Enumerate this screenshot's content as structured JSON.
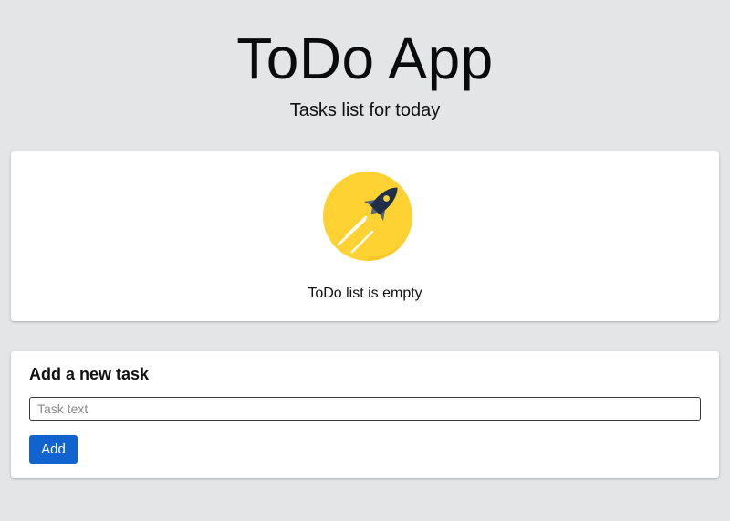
{
  "header": {
    "title": "ToDo App",
    "subtitle": "Tasks list for today"
  },
  "empty_state": {
    "icon": "rocket-icon",
    "message": "ToDo list is empty"
  },
  "add_task": {
    "heading": "Add a new task",
    "input_value": "",
    "input_placeholder": "Task text",
    "button_label": "Add"
  },
  "colors": {
    "background": "#e4e5e7",
    "card": "#ffffff",
    "accent": "#1163d0",
    "rocket_circle": "#fdd232",
    "rocket_body": "#1f2f4a"
  }
}
